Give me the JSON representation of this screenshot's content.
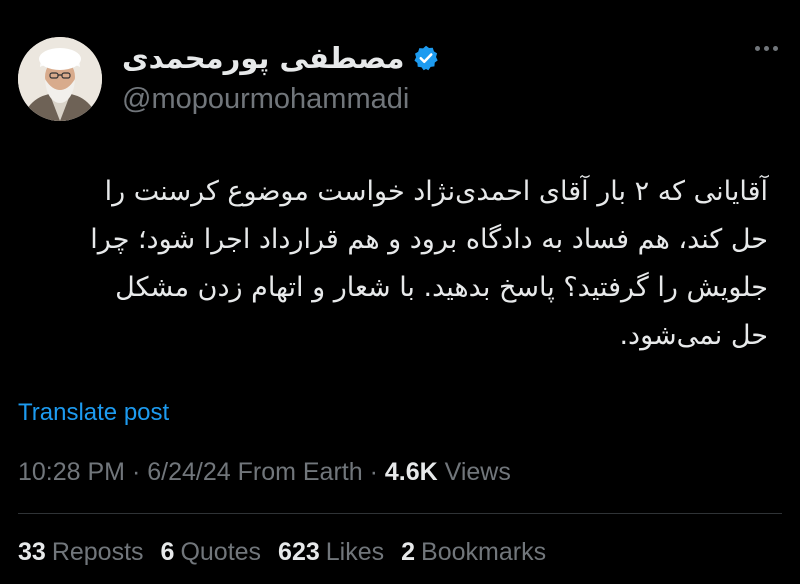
{
  "author": {
    "display_name": "مصطفی پورمحمدی",
    "handle": "@mopourmohammadi",
    "verified": true
  },
  "tweet": {
    "lines": [
      "آقایانی که ۲ بار آقای احمدی‌نژاد خواست موضوع کرسنت را",
      "حل کند، هم فساد به دادگاه برود و هم قرارداد اجرا شود؛ چرا",
      "جلویش را گرفتید؟ پاسخ بدهید. با شعار و اتهام زدن مشکل",
      "حل نمی‌شود."
    ]
  },
  "translate_label": "Translate post",
  "meta": {
    "time": "10:28 PM",
    "sep": " · ",
    "date": "6/24/24",
    "source": "From Earth",
    "views_count": "4.6K",
    "views_label": "Views"
  },
  "stats": [
    {
      "count": "33",
      "label": "Reposts"
    },
    {
      "count": "6",
      "label": "Quotes"
    },
    {
      "count": "623",
      "label": "Likes"
    },
    {
      "count": "2",
      "label": "Bookmarks"
    }
  ],
  "colors": {
    "background": "#000000",
    "text": "#e7e9ea",
    "secondary": "#71767b",
    "accent": "#1d9bf0"
  },
  "icons": {
    "verified": "verified-badge-icon",
    "more": "more-options-icon"
  }
}
